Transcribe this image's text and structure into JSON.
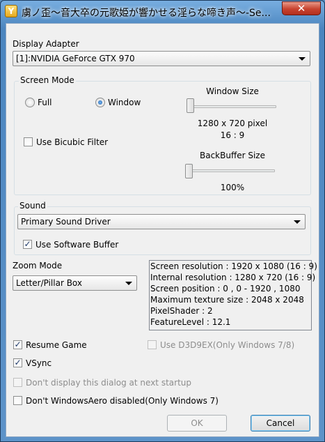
{
  "window": {
    "title": "虜ノ歪〜音大卒の元歌姫が響かせる淫らな啼き声〜-Se...",
    "app_icon_glyph": "Y",
    "close_glyph": "✕"
  },
  "display_adapter": {
    "label": "Display Adapter",
    "selected": "[1]:NVIDIA GeForce GTX 970"
  },
  "screen_mode": {
    "label": "Screen Mode",
    "full_label": "Full",
    "window_label": "Window",
    "selected": "Window",
    "bicubic_label": "Use Bicubic Filter",
    "bicubic_checked": false,
    "window_size_label": "Window Size",
    "window_size_value": "1280 x 720 pixel",
    "window_aspect": "16 : 9",
    "backbuffer_label": "BackBuffer Size",
    "backbuffer_value": "100%"
  },
  "sound": {
    "label": "Sound",
    "selected": "Primary Sound Driver",
    "software_buffer_label": "Use Software Buffer",
    "software_buffer_checked": true
  },
  "zoom": {
    "label": "Zoom Mode",
    "selected": "Letter/Pillar Box"
  },
  "info_lines": [
    "Screen resolution : 1920 x 1080 (16 : 9)",
    "Internal resolution : 1280 x 720 (16 : 9)",
    "Screen position : 0 , 0 - 1920 , 1080",
    "Maximum texture size : 2048 x 2048",
    "PixelShader : 2",
    "FeatureLevel : 12.1"
  ],
  "options": {
    "resume_game": "Resume Game",
    "vsync": "VSync",
    "use_d3d9ex": "Use D3D9EX(Only Windows 7/8)",
    "dont_display": "Don't display this dialog at next startup",
    "dont_aero": "Don't WindowsAero disabled(Only Windows 7)",
    "check_glyph": "✓"
  },
  "buttons": {
    "ok": "OK",
    "cancel": "Cancel"
  },
  "colors": {
    "titlebar": "#5d93c9",
    "close": "#c8432f",
    "dialog_bg": "#f0f0f0",
    "focus_border": "#3c7fb1"
  }
}
